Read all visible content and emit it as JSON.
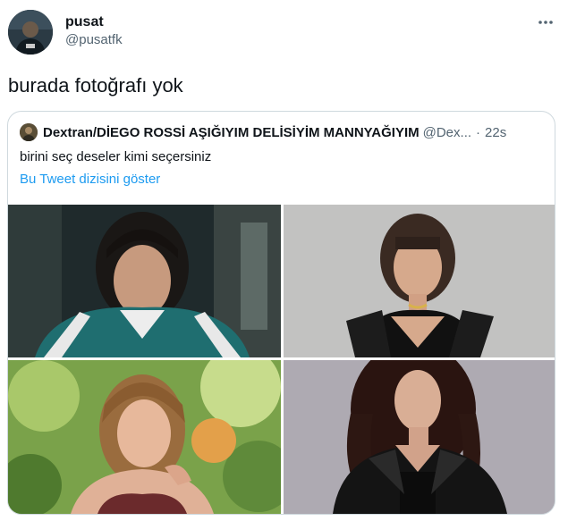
{
  "tweet": {
    "display_name": "pusat",
    "handle": "@pusatfk",
    "text": "burada fotoğrafı yok"
  },
  "quote": {
    "display_name": "Dextran/DİEGO ROSSİ AŞIĞIYIM DELİSİYİM MANNYAĞIYIM",
    "handle": "@Dex...",
    "separator": "·",
    "time": "22s",
    "text": "birini seç deseler kimi seçersiniz",
    "thread_link": "Bu Tweet dizisini göster"
  },
  "colors": {
    "text_primary": "#0f1419",
    "text_secondary": "#536471",
    "link": "#1d9bf0",
    "border": "#cfd9de"
  },
  "icons": {
    "more": "more-horizontal-icon"
  }
}
